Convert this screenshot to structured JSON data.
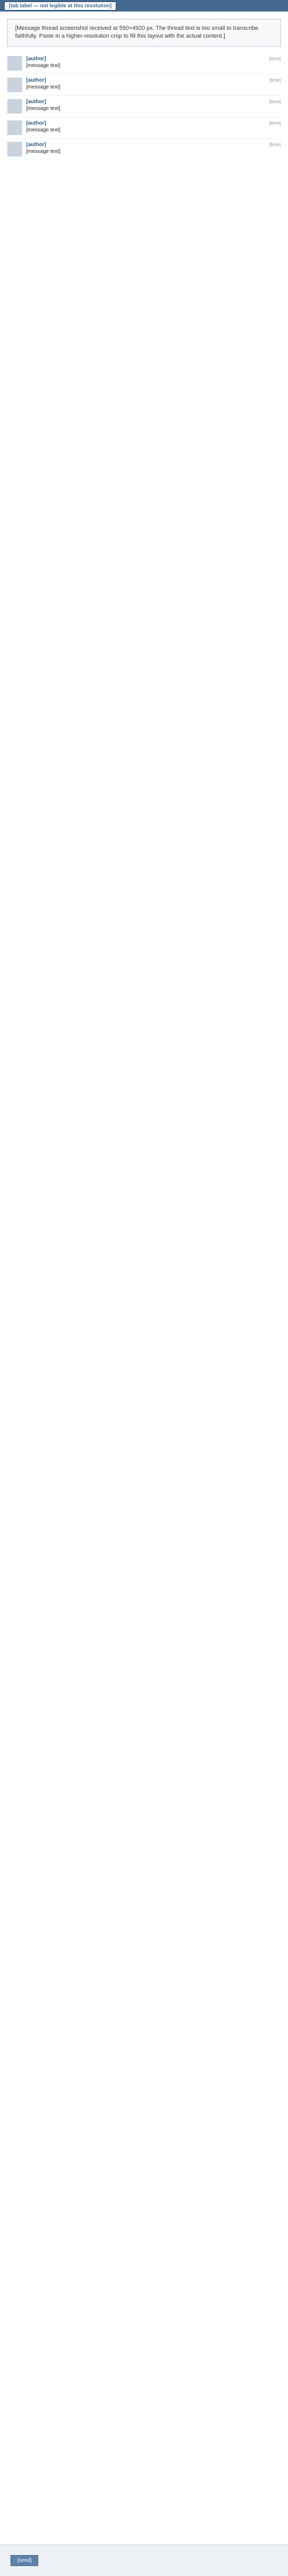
{
  "window": {
    "tab_label": "[tab label — not legible at this resolution]"
  },
  "notice": {
    "text": "[Message thread screenshot received at 550×4920 px. The thread text is too small to transcribe faithfully. Paste in a higher-resolution crop to fill this layout with the actual content.]"
  },
  "messages": [
    {
      "author": "[author]",
      "time": "[time]",
      "text": "[message text]"
    },
    {
      "author": "[author]",
      "time": "[time]",
      "text": "[message text]"
    },
    {
      "author": "[author]",
      "time": "[time]",
      "text": "[message text]"
    },
    {
      "author": "[author]",
      "time": "[time]",
      "text": "[message text]"
    },
    {
      "author": "[author]",
      "time": "[time]",
      "text": "[message text]"
    }
  ],
  "composer": {
    "send_label": "[send]"
  },
  "colors": {
    "header_bar": "#45688e",
    "author_link": "#2b587a",
    "send_button": "#5e81a8"
  }
}
